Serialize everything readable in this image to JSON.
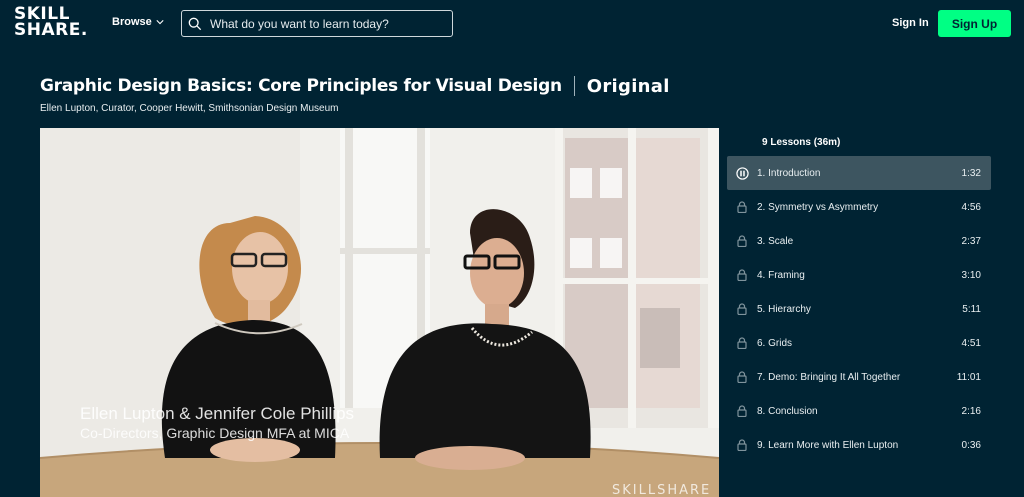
{
  "header": {
    "logo_line1": "SKILL",
    "logo_line2": "SHARE.",
    "browse_label": "Browse",
    "search_placeholder": "What do you want to learn today?",
    "signin_label": "Sign In",
    "signup_label": "Sign Up"
  },
  "course": {
    "title": "Graphic Design Basics: Core Principles for Visual Design",
    "badge": "Original",
    "teacher": "Ellen Lupton, Curator, Cooper Hewitt, Smithsonian Design Museum"
  },
  "video": {
    "caption_name": "Ellen Lupton & Jennifer Cole Phillips",
    "caption_role": "Co-Directors, Graphic Design MFA at MICA",
    "watermark": "SKILLSHARE"
  },
  "lessons": {
    "count_label": "9 Lessons (36m)",
    "items": [
      {
        "label": "1. Introduction",
        "duration": "1:32",
        "state": "playing",
        "icon": "pause-icon"
      },
      {
        "label": "2. Symmetry vs Asymmetry",
        "duration": "4:56",
        "state": "locked",
        "icon": "lock-icon"
      },
      {
        "label": "3. Scale",
        "duration": "2:37",
        "state": "locked",
        "icon": "lock-icon"
      },
      {
        "label": "4. Framing",
        "duration": "3:10",
        "state": "locked",
        "icon": "lock-icon"
      },
      {
        "label": "5. Hierarchy",
        "duration": "5:11",
        "state": "locked",
        "icon": "lock-icon"
      },
      {
        "label": "6. Grids",
        "duration": "4:51",
        "state": "locked",
        "icon": "lock-icon"
      },
      {
        "label": "7. Demo: Bringing It All Together",
        "duration": "11:01",
        "state": "locked",
        "icon": "lock-icon"
      },
      {
        "label": "8. Conclusion",
        "duration": "2:16",
        "state": "locked",
        "icon": "lock-icon"
      },
      {
        "label": "9. Learn More with Ellen Lupton",
        "duration": "0:36",
        "state": "locked",
        "icon": "lock-icon"
      }
    ]
  },
  "colors": {
    "background": "#002333",
    "accent": "#00ff84",
    "active_row": "#3d5560"
  }
}
